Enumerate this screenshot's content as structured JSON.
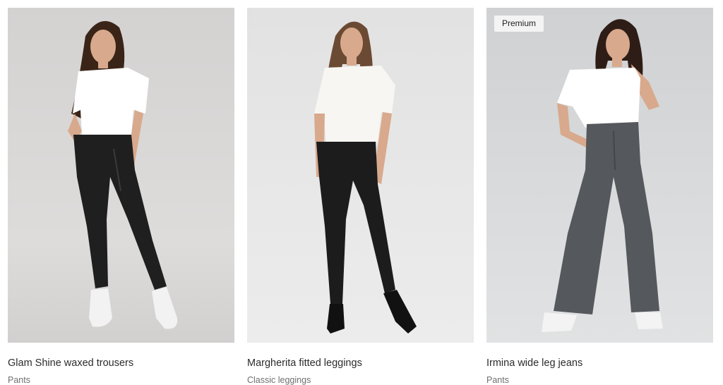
{
  "products": [
    {
      "name": "Glam Shine waxed trousers",
      "category": "Pants",
      "badge": "",
      "image": "model-white-tee-black-waxed-trousers-photo"
    },
    {
      "name": "Margherita fitted leggings",
      "category": "Classic leggings",
      "badge": "",
      "image": "model-white-tee-black-leggings-heels-photo"
    },
    {
      "name": "Irmina wide leg jeans",
      "category": "Pants",
      "badge": "Premium",
      "image": "model-white-top-grey-wide-jeans-photo"
    }
  ],
  "colors": {
    "photo_bg_1": "#d9d7d6",
    "photo_bg_2": "#e6e6e6",
    "photo_bg_3": "#d3d5d7",
    "top": "#ffffff",
    "black_pants": "#1f1f1f",
    "grey_jeans": "#55585c",
    "skin": "#d8a98c",
    "hair": "#3a2418",
    "badge_bg": "#f4f4f4"
  }
}
